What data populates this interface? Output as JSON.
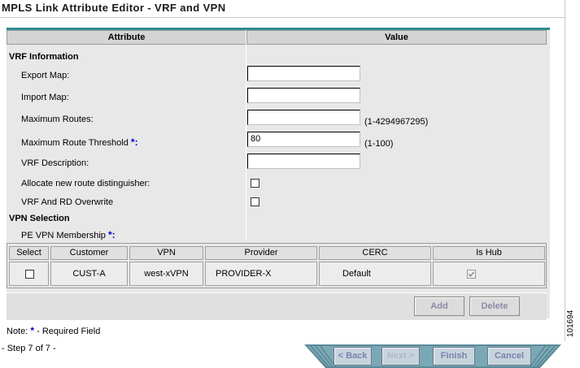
{
  "page": {
    "title": "MPLS Link Attribute Editor - VRF and VPN",
    "side_id": "101694"
  },
  "table": {
    "col_attribute": "Attribute",
    "col_value": "Value"
  },
  "vrf": {
    "section": "VRF Information",
    "export_map": {
      "label": "Export Map:",
      "value": ""
    },
    "import_map": {
      "label": "Import Map:",
      "value": ""
    },
    "max_routes": {
      "label": "Maximum Routes:",
      "value": "",
      "hint": "(1-4294967295)"
    },
    "max_route_threshold": {
      "label": "Maximum Route Threshold",
      "value": "80",
      "hint": "(1-100)",
      "req": "*:"
    },
    "vrf_description": {
      "label": "VRF Description:",
      "value": ""
    },
    "allocate_rd": {
      "label": "Allocate new route distinguisher:",
      "checked": false
    },
    "vrf_rd_overwrite": {
      "label": "VRF And RD Overwrite",
      "checked": false
    }
  },
  "vpn": {
    "section": "VPN Selection",
    "membership_label": "PE VPN Membership",
    "membership_req": "*:",
    "headers": [
      "Select",
      "Customer",
      "VPN",
      "Provider",
      "CERC",
      "Is Hub"
    ],
    "rows": [
      {
        "selected": false,
        "customer": "CUST-A",
        "vpn": "west-xVPN",
        "provider": "PROVIDER-X",
        "cerc": "Default",
        "is_hub": true
      }
    ],
    "add_label": "Add",
    "delete_label": "Delete"
  },
  "footer": {
    "note_prefix": "Note:",
    "note_star": "*",
    "note_suffix": "- Required Field",
    "step": "- Step 7 of 7 -",
    "back": "< Back",
    "next": "Next >",
    "finish": "Finish",
    "cancel": "Cancel"
  },
  "colors": {
    "accent": "#2e8b94",
    "required": "#0000cc",
    "panel": "#e8e8e8"
  }
}
